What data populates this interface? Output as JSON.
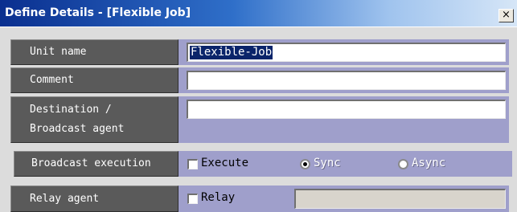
{
  "window": {
    "title": "Define Details - [Flexible Job]",
    "close_label": "×"
  },
  "rows": {
    "unit_name": {
      "label": "Unit name",
      "value": "Flexible-Job"
    },
    "comment": {
      "label": "Comment",
      "value": ""
    },
    "destination": {
      "label_line1": "Destination /",
      "label_line2": "Broadcast agent",
      "value": ""
    },
    "broadcast": {
      "label": "Broadcast execution",
      "execute_label": "Execute",
      "sync_label": "Sync",
      "async_label": "Async",
      "execute_checked": false,
      "selected": "Sync"
    },
    "relay": {
      "label": "Relay agent",
      "relay_label": "Relay",
      "relay_checked": false,
      "value": ""
    }
  },
  "colors": {
    "title_bar_start": "#0a2f8f",
    "label_bg": "#5a5a5a",
    "value_bg": "#9f9fcb",
    "selection": "#0a246a"
  }
}
